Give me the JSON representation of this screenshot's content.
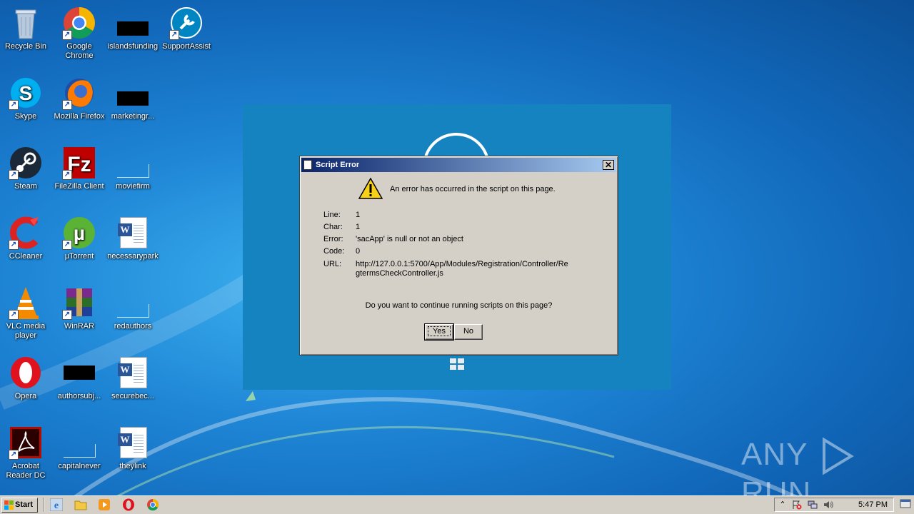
{
  "desktop": {
    "icons": [
      {
        "label": "Recycle Bin",
        "icon": "recycle-bin-icon"
      },
      {
        "label": "Google Chrome",
        "icon": "chrome-icon"
      },
      {
        "label": "islandsfunding",
        "icon": "file-thumbnail-icon"
      },
      {
        "label": "SupportAssist",
        "icon": "supportassist-icon"
      },
      {
        "label": "Skype",
        "icon": "skype-icon"
      },
      {
        "label": "Mozilla Firefox",
        "icon": "firefox-icon"
      },
      {
        "label": "marketingr...",
        "icon": "file-thumbnail-icon"
      },
      {
        "label": "Steam",
        "icon": "steam-icon"
      },
      {
        "label": "FileZilla Client",
        "icon": "filezilla-icon"
      },
      {
        "label": "moviefirm",
        "icon": "file-thumbnail-icon"
      },
      {
        "label": "CCleaner",
        "icon": "ccleaner-icon"
      },
      {
        "label": "µTorrent",
        "icon": "utorrent-icon"
      },
      {
        "label": "necessarypark",
        "icon": "word-document-icon"
      },
      {
        "label": "VLC media player",
        "icon": "vlc-icon"
      },
      {
        "label": "WinRAR",
        "icon": "winrar-icon"
      },
      {
        "label": "redauthors",
        "icon": "file-thumbnail-icon"
      },
      {
        "label": "Opera",
        "icon": "opera-icon"
      },
      {
        "label": "authorsubj...",
        "icon": "file-thumbnail-icon"
      },
      {
        "label": "securebec...",
        "icon": "word-document-icon"
      },
      {
        "label": "Acrobat Reader DC",
        "icon": "acrobat-icon"
      },
      {
        "label": "capitalnever",
        "icon": "file-thumbnail-icon"
      },
      {
        "label": "theylink",
        "icon": "word-document-icon"
      }
    ]
  },
  "dialog": {
    "title": "Script Error",
    "message": "An error has occurred in the script on this page.",
    "fields": {
      "line_label": "Line:",
      "line_value": "1",
      "char_label": "Char:",
      "char_value": "1",
      "error_label": "Error:",
      "error_value": "'sacApp' is null or not an object",
      "code_label": "Code:",
      "code_value": "0",
      "url_label": "URL:",
      "url_value": "http://127.0.0.1:5700/App/Modules/Registration/Controller/RegtermsCheckController.js"
    },
    "question": "Do you want to continue running scripts on this page?",
    "yes_label": "Yes",
    "no_label": "No",
    "close_glyph": "✕"
  },
  "watermark": {
    "left": "ANY",
    "right": "RUN"
  },
  "taskbar": {
    "start_label": "Start",
    "quick_launch": [
      "internet-explorer-icon",
      "folder-icon",
      "media-player-icon",
      "opera-icon",
      "chrome-icon"
    ],
    "tray_expand": "⌃",
    "clock": "5:47 PM"
  },
  "colors": {
    "desktop": "#1f86d6",
    "dialog_title_start": "#0a246a",
    "dialog_face": "#d4d0c8",
    "bg_window": "#1583bf"
  }
}
